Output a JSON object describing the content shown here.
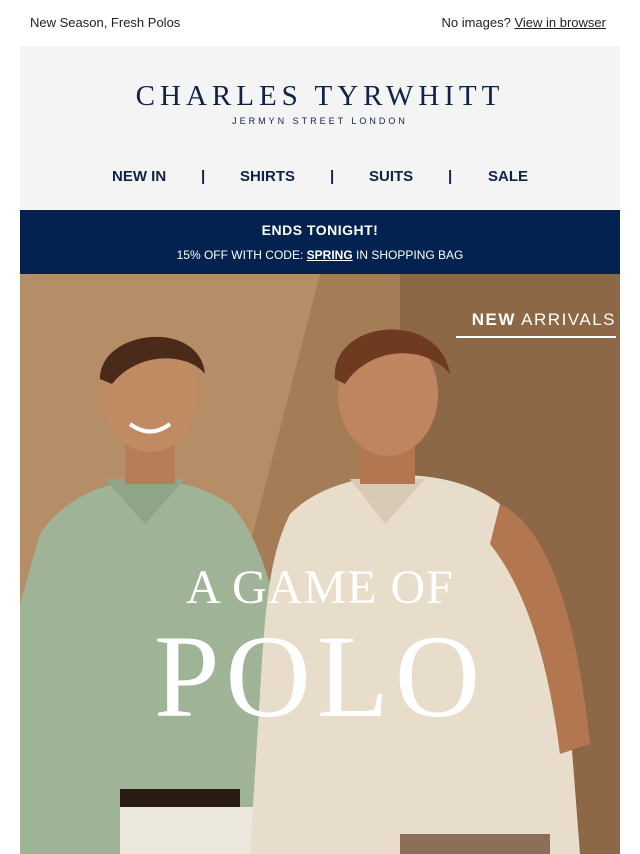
{
  "preheader": {
    "left_text": "New Season, Fresh Polos",
    "right_prefix": "No images?",
    "right_link": "View in browser"
  },
  "brand": {
    "name": "CHARLES TYRWHITT",
    "tagline": "JERMYN STREET LONDON",
    "color": "#0e2346"
  },
  "nav": {
    "items": [
      "NEW IN",
      "SHIRTS",
      "SUITS",
      "SALE"
    ],
    "separator": "|"
  },
  "promo": {
    "title": "ENDS TONIGHT!",
    "prefix": "15% OFF WITH CODE:",
    "code": "SPRING",
    "suffix": "IN SHOPPING BAG",
    "background": "#03224f"
  },
  "hero": {
    "badge_bold": "NEW",
    "badge_rest": "ARRIVALS",
    "title_line1": "A GAME OF",
    "title_line2": "POLO"
  }
}
